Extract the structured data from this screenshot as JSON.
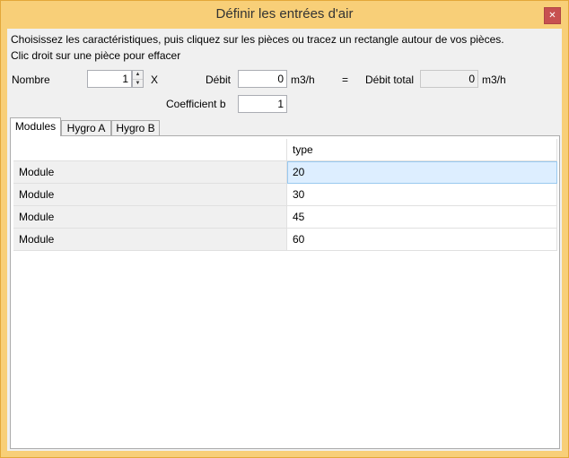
{
  "window": {
    "title": "Définir les entrées d'air",
    "close_glyph": "✕"
  },
  "instructions": {
    "line1": "Choisissez les caractéristiques, puis cliquez sur les pièces ou tracez un rectangle autour de vos pièces.",
    "line2": "Clic droit sur une pièce pour effacer"
  },
  "form": {
    "nombre_label": "Nombre",
    "nombre_value": "1",
    "x_label": "X",
    "debit_label": "Débit",
    "debit_value": "0",
    "unit1": "m3/h",
    "equals": "=",
    "total_label": "Débit total",
    "total_value": "0",
    "unit2": "m3/h",
    "coef_label": "Coefficient b",
    "coef_value": "1"
  },
  "tabs": [
    {
      "label": "Modules"
    },
    {
      "label": "Hygro A"
    },
    {
      "label": "Hygro B"
    }
  ],
  "grid": {
    "header": {
      "col1": "",
      "col2": "type"
    },
    "rows": [
      {
        "name": "Module",
        "type": "20"
      },
      {
        "name": "Module",
        "type": "30"
      },
      {
        "name": "Module",
        "type": "45"
      },
      {
        "name": "Module",
        "type": "60"
      }
    ]
  }
}
